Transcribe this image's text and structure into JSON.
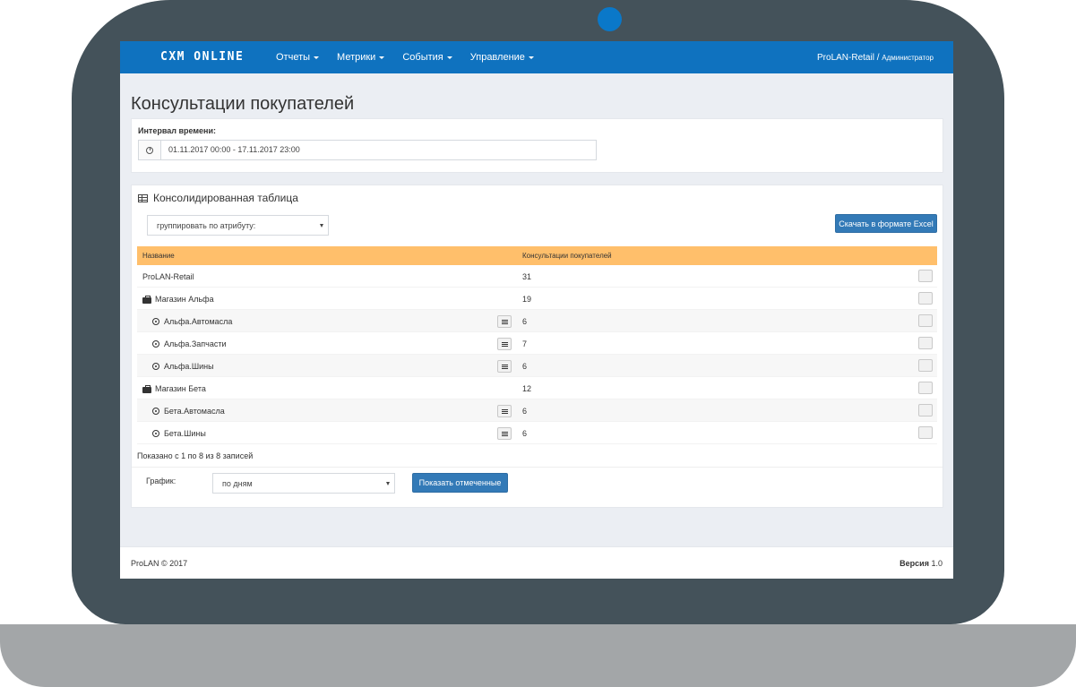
{
  "navbar": {
    "brand": "CXM ONLINE",
    "menu": [
      {
        "label": "Отчеты"
      },
      {
        "label": "Метрики"
      },
      {
        "label": "События"
      },
      {
        "label": "Управление"
      }
    ],
    "user": "ProLAN-Retail",
    "separator": " / ",
    "role": "Администратор"
  },
  "page": {
    "title": "Консультации покупателей"
  },
  "time_filter": {
    "label": "Интервал времени:",
    "value": "01.11.2017 00:00 - 17.11.2017 23:00"
  },
  "table_panel": {
    "title": "Консолидированная таблица",
    "group_select": "группировать по атрибуту:",
    "excel_button": "Скачать в формате Excel",
    "columns": [
      "Название",
      "Консультации покупателей"
    ],
    "rows": [
      {
        "name": "ProLAN-Retail",
        "value": "31",
        "level": 0,
        "icon": "none"
      },
      {
        "name": "Магазин Альфа",
        "value": "19",
        "level": 1,
        "icon": "briefcase-icon"
      },
      {
        "name": "Альфа.Автомасла",
        "value": "6",
        "level": 2,
        "icon": "target-icon"
      },
      {
        "name": "Альфа.Запчасти",
        "value": "7",
        "level": 2,
        "icon": "target-icon"
      },
      {
        "name": "Альфа.Шины",
        "value": "6",
        "level": 2,
        "icon": "target-icon"
      },
      {
        "name": "Магазин Бета",
        "value": "12",
        "level": 1,
        "icon": "briefcase-icon"
      },
      {
        "name": "Бета.Автомасла",
        "value": "6",
        "level": 2,
        "icon": "target-icon"
      },
      {
        "name": "Бета.Шины",
        "value": "6",
        "level": 2,
        "icon": "target-icon"
      }
    ],
    "info": "Показано с 1 по 8 из 8 записей",
    "chart_label": "График:",
    "chart_select": "по дням",
    "show_button": "Показать отмеченные"
  },
  "footer": {
    "copyright": "ProLAN © 2017",
    "version_label": "Версия",
    "version_value": "1.0"
  },
  "colors": {
    "navbar": "#0f72bf",
    "table_header": "#ffbf6b",
    "button": "#337ab7",
    "bezel": "#44525a"
  }
}
